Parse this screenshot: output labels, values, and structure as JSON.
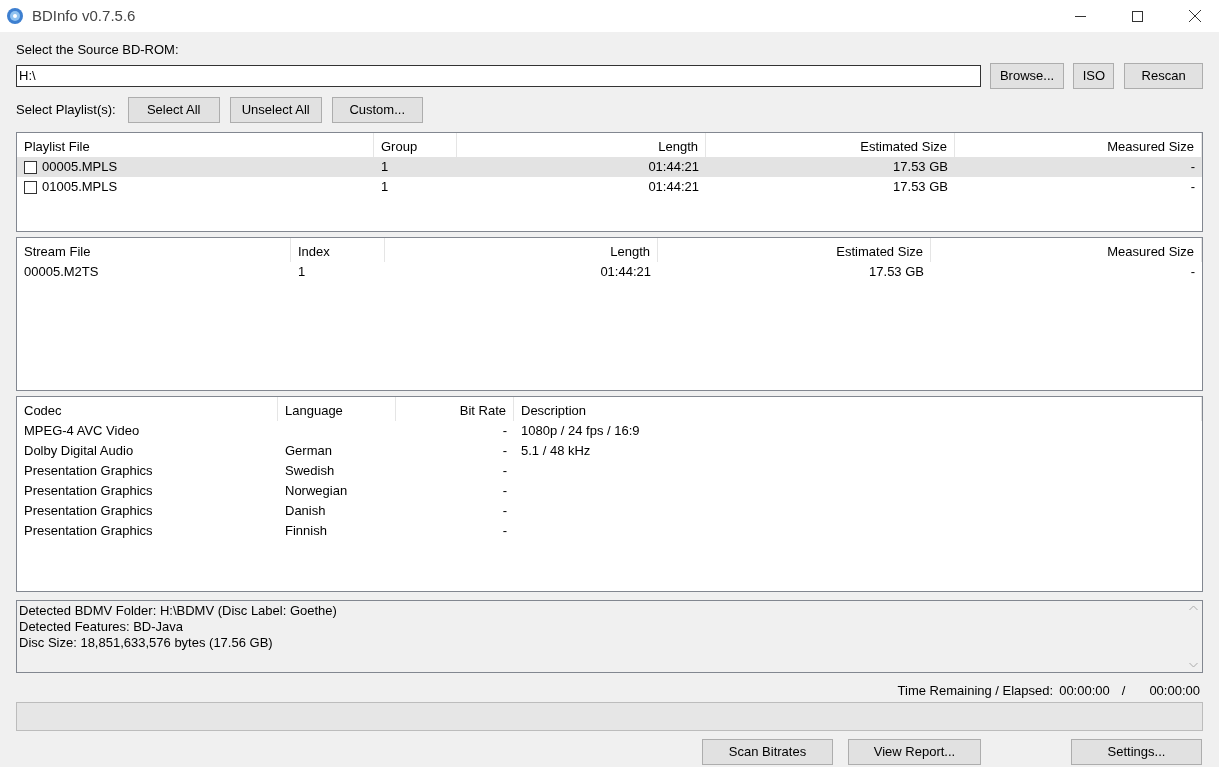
{
  "window": {
    "title": "BDInfo v0.7.5.6"
  },
  "source": {
    "label": "Select the Source BD-ROM:",
    "value": "H:\\",
    "buttons": [
      "Browse...",
      "ISO",
      "Rescan"
    ]
  },
  "playlist_select": {
    "label": "Select Playlist(s):",
    "buttons": [
      "Select All",
      "Unselect All",
      "Custom..."
    ]
  },
  "playlist_table": {
    "columns": [
      "Playlist File",
      "Group",
      "Length",
      "Estimated Size",
      "Measured Size"
    ],
    "rows": [
      {
        "checked": false,
        "selected": true,
        "cells": [
          "00005.MPLS",
          "1",
          "01:44:21",
          "17.53 GB",
          "-"
        ]
      },
      {
        "checked": false,
        "selected": false,
        "cells": [
          "01005.MPLS",
          "1",
          "01:44:21",
          "17.53 GB",
          "-"
        ]
      }
    ]
  },
  "stream_table": {
    "columns": [
      "Stream File",
      "Index",
      "Length",
      "Estimated Size",
      "Measured Size"
    ],
    "rows": [
      {
        "cells": [
          "00005.M2TS",
          "1",
          "01:44:21",
          "17.53 GB",
          "-"
        ]
      }
    ]
  },
  "codec_table": {
    "columns": [
      "Codec",
      "Language",
      "Bit Rate",
      "Description"
    ],
    "rows": [
      {
        "cells": [
          "MPEG-4 AVC Video",
          "",
          "-",
          "1080p / 24 fps / 16:9"
        ]
      },
      {
        "cells": [
          "Dolby Digital Audio",
          "German",
          "-",
          "5.1 / 48 kHz"
        ]
      },
      {
        "cells": [
          "Presentation Graphics",
          "Swedish",
          "-",
          ""
        ]
      },
      {
        "cells": [
          "Presentation Graphics",
          "Norwegian",
          "-",
          ""
        ]
      },
      {
        "cells": [
          "Presentation Graphics",
          "Danish",
          "-",
          ""
        ]
      },
      {
        "cells": [
          "Presentation Graphics",
          "Finnish",
          "-",
          ""
        ]
      }
    ]
  },
  "info_lines": [
    "Detected BDMV Folder: H:\\BDMV (Disc Label: Goethe)",
    "Detected Features: BD-Java",
    "Disc Size: 18,851,633,576 bytes (17.56 GB)"
  ],
  "time": {
    "label": "Time Remaining / Elapsed:",
    "remaining": "00:00:00",
    "separator": "/",
    "elapsed": "00:00:00"
  },
  "progress": {
    "level": 0
  },
  "bottom_buttons": [
    "Scan Bitrates",
    "View Report...",
    "Settings..."
  ]
}
